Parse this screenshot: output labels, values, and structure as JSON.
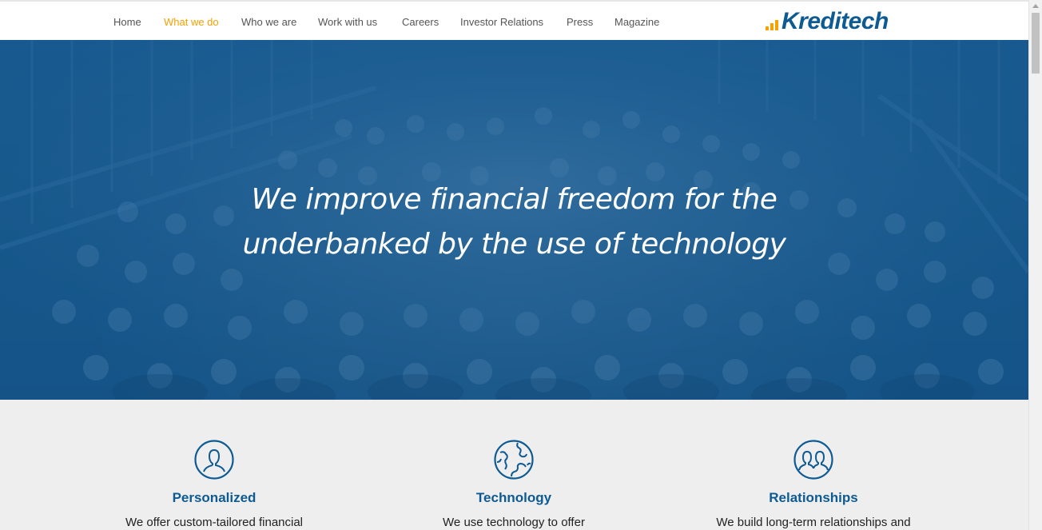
{
  "nav": {
    "items": [
      {
        "label": "Home"
      },
      {
        "label": "What we do"
      },
      {
        "label": "Who we are"
      },
      {
        "label": "Work with us"
      },
      {
        "label": "Careers"
      },
      {
        "label": "Investor Relations"
      },
      {
        "label": "Press"
      },
      {
        "label": "Magazine"
      }
    ],
    "active_item": "What we do"
  },
  "logo": {
    "text": "Kreditech",
    "icon": "bar-chart-icon"
  },
  "hero": {
    "line1": "We improve financial freedom for the",
    "line2": "underbanked by the use of technology"
  },
  "features": [
    {
      "title": "Personalized",
      "text": "We offer custom-tailored financial",
      "icon": "person-icon"
    },
    {
      "title": "Technology",
      "text": "We use technology to offer",
      "icon": "globe-icon"
    },
    {
      "title": "Relationships",
      "text": "We build long-term relationships and",
      "icon": "people-icon"
    }
  ],
  "colors": {
    "accent": "#f5a100",
    "brand": "#0e5a92",
    "hero": "#1a5a8c",
    "features_bg": "#eeeeee"
  }
}
